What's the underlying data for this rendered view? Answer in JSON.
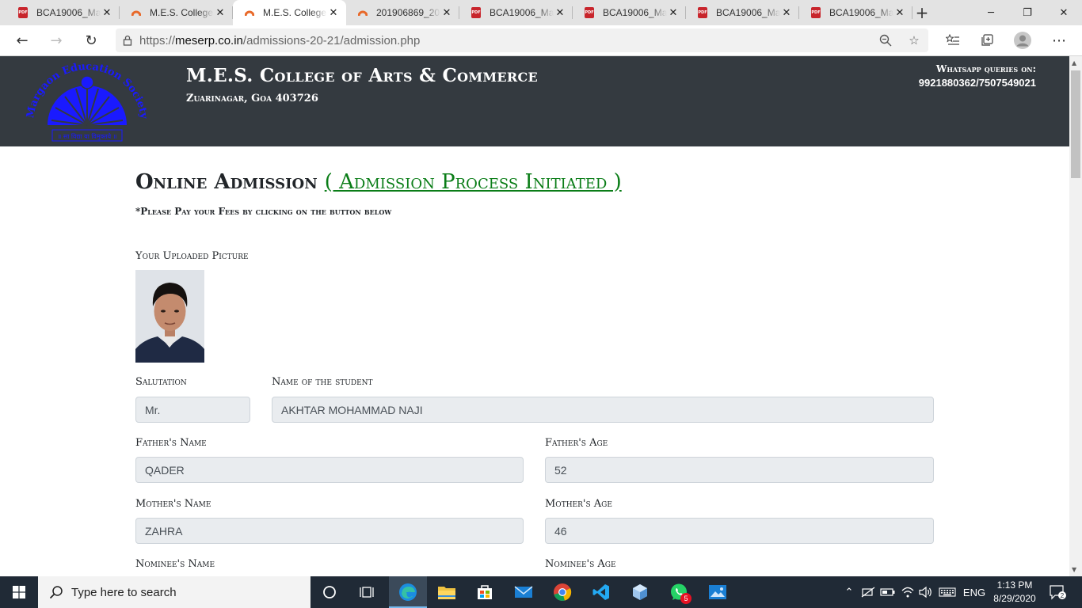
{
  "browser": {
    "tabs": [
      {
        "label": "BCA19006_Ma",
        "icon": "pdf-icon"
      },
      {
        "label": "M.E.S. College",
        "icon": "mes-favicon"
      },
      {
        "label": "M.E.S. College",
        "icon": "mes-favicon",
        "active": true
      },
      {
        "label": "201906869_20",
        "icon": "mes-favicon"
      },
      {
        "label": "BCA19006_Ma",
        "icon": "pdf-icon"
      },
      {
        "label": "BCA19006_Ma",
        "icon": "pdf-icon"
      },
      {
        "label": "BCA19006_Ma",
        "icon": "pdf-icon"
      },
      {
        "label": "BCA19006_Ma",
        "icon": "pdf-icon"
      }
    ],
    "pdf_icon_text": "PDF",
    "url_prefix": "https://",
    "url_host": "meserp.co.in",
    "url_path": "/admissions-20-21/admission.php"
  },
  "header": {
    "logo_text": "Margaon Education Society",
    "logo_motto": "॥ सा विद्या या विमुक्तये ॥",
    "college_name": "M.E.S. College of Arts & Commerce",
    "college_address": "Zuarinagar, Goa 403726",
    "whatsapp_label": "Whatsapp queries on:",
    "whatsapp_numbers": "9921880362/7507549021",
    "bg_color": "#343a40"
  },
  "content": {
    "title": "Online Admission",
    "status": "( Admission Process Initiated )",
    "status_color": "#0a7d17",
    "pay_note": "*Please Pay your Fees by clicking on the button below",
    "picture_label": "Your Uploaded Picture",
    "fields": {
      "salutation": {
        "label": "Salutation",
        "value": "Mr."
      },
      "student_name": {
        "label": "Name of the student",
        "value": "AKHTAR MOHAMMAD NAJI"
      },
      "father_name": {
        "label": "Father's Name",
        "value": "QADER"
      },
      "father_age": {
        "label": "Father's Age",
        "value": "52"
      },
      "mother_name": {
        "label": "Mother's Name",
        "value": "ZAHRA"
      },
      "mother_age": {
        "label": "Mother's Age",
        "value": "46"
      },
      "nominee_name": {
        "label": "Nominee's Name"
      },
      "nominee_age": {
        "label": "Nominee's Age"
      }
    }
  },
  "taskbar": {
    "search_placeholder": "Type here to search",
    "whatsapp_badge": "5",
    "language": "ENG",
    "time": "1:13 PM",
    "date": "8/29/2020",
    "notification_count": "2"
  }
}
